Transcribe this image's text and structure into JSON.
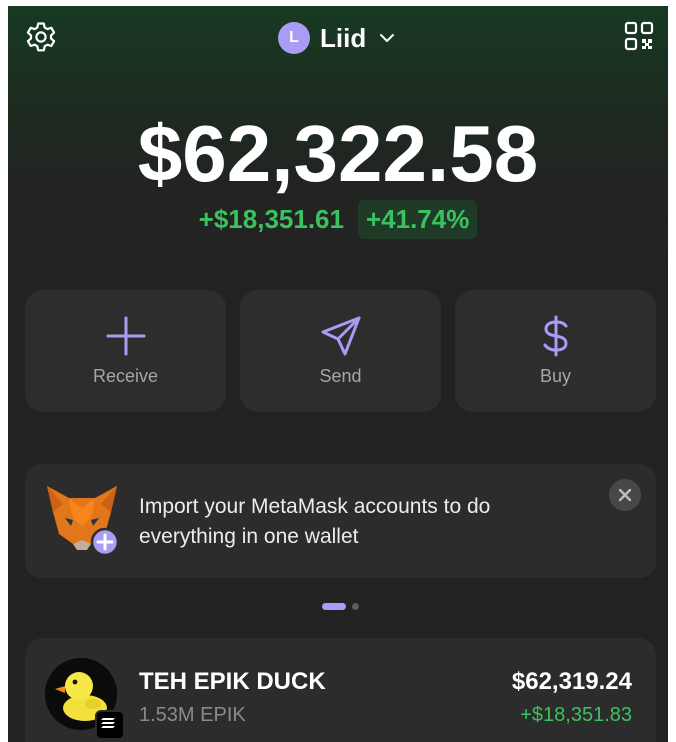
{
  "header": {
    "account_initial": "L",
    "account_name": "Liid",
    "icons": [
      "gear-icon",
      "chevron-down-icon",
      "qr-code-icon"
    ]
  },
  "portfolio": {
    "balance": "$62,322.58",
    "change_amount": "+$18,351.61",
    "change_percent": "+41.74%"
  },
  "actions": [
    {
      "label": "Receive",
      "icon": "plus-icon"
    },
    {
      "label": "Send",
      "icon": "send-icon"
    },
    {
      "label": "Buy",
      "icon": "dollar-icon"
    }
  ],
  "banner": {
    "text": "Import your MetaMask accounts to do everything in one wallet",
    "icon": "metamask-fox-icon"
  },
  "pager": {
    "pages": 2,
    "active": 1
  },
  "tokens": [
    {
      "name": "TEH EPIK DUCK",
      "amount": "1.53M EPIK",
      "value": "$62,319.24",
      "change": "+$18,351.83",
      "icon": "duck-token-icon",
      "chain_icon": "solana-icon"
    }
  ],
  "colors": {
    "accent": "#a99cf4",
    "positive": "#3ac25f",
    "card": "#2d2d2d",
    "background": "#222222"
  }
}
